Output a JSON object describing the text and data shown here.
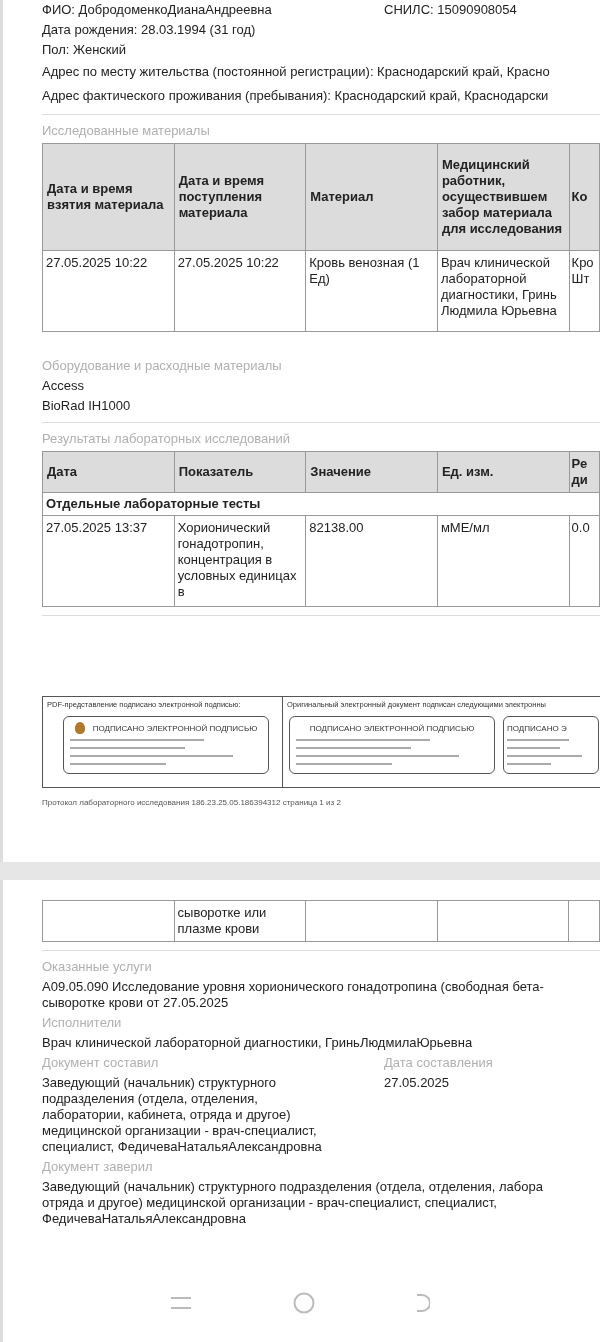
{
  "patient": {
    "name": "ФИО: ДобродоменкоДианаАндреевна",
    "snils": "СНИЛС: 15090908054",
    "birth": "Дата рождения: 28.03.1994 (31 год)",
    "sex": "Пол: Женский",
    "reg_address": "Адрес по месту жительства (постоянной регистрации): Краснодарский край, Красно",
    "actual_address": "Адрес фактического проживания (пребывания): Краснодарский край, Краснодарски"
  },
  "materials": {
    "title": "Исследованные материалы",
    "columns": [
      "Дата и время взятия материала",
      "Дата и время поступления материала",
      "Материал",
      "Медицинский работник, осуществившем забор материала для исследования",
      "Ко"
    ],
    "rows": [
      [
        "27.05.2025 10:22",
        "27.05.2025 10:22",
        "Кровь венозная (1 Ед)",
        "Врач клинической лабораторной диагностики, Гринь Людмила Юрьевна",
        "Кро Шт"
      ]
    ]
  },
  "equipment": {
    "title": "Оборудование и расходные материалы",
    "items": [
      "Access",
      "BioRad IH1000"
    ]
  },
  "results": {
    "title": "Результаты лабораторных исследований",
    "columns": [
      "Дата",
      "Показатель",
      "Значение",
      "Ед. изм.",
      "Ре ди"
    ],
    "group": "Отдельные лабораторные тесты",
    "rows": [
      [
        "27.05.2025 13:37",
        "Хорионический гонадотропин, концентрация в условных единицах в",
        "82138.00",
        "мМЕ/мл",
        "0.0"
      ]
    ]
  },
  "signatures": {
    "pdf_label": "PDF-представление подписано электронной подписью:",
    "original_label": "Оригинальный электронный документ подписан следующими электронны",
    "stamps": [
      {
        "heading": "ПОДПИСАНО ЭЛЕКТРОННОЙ ПОДПИСЬЮ",
        "kind": "emblem"
      },
      {
        "heading": "ПОДПИСАНО ЭЛЕКТРОННОЙ ПОДПИСЬЮ",
        "kind": "plain"
      },
      {
        "heading": "ПОДПИСАНО Э",
        "kind": "plain"
      }
    ]
  },
  "footer": "Протокол лабораторного исследования 186.23.25.05.186394312 страница 1 из 2",
  "page2": {
    "continued_row": {
      "indicator": "сыворотке или плазме крови"
    },
    "services": {
      "title": "Оказанные услуги",
      "lines": [
        "A09.05.090 Исследование уровня хорионического гонадотропина (свободная бета-",
        "сыворотке крови от 27.05.2025"
      ]
    },
    "performers": {
      "title": "Исполнители",
      "text": "Врач клинической лабораторной диагностики, ГриньЛюдмилаЮрьевна"
    },
    "composer": {
      "title": "Документ составил",
      "lines": [
        "Заведующий (начальник) структурного",
        "подразделения (отдела, отделения,",
        "лаборатории, кабинета, отряда и другое)",
        "медицинской организации - врач-специалист,",
        "специалист, ФедичеваНатальяАлександровна"
      ]
    },
    "date": {
      "title": "Дата составления",
      "text": "27.05.2025"
    },
    "certifier": {
      "title": "Документ заверил",
      "lines": [
        "Заведующий (начальник) структурного подразделения (отдела, отделения, лабора",
        "отряда и другое) медицинской организации - врач-специалист, специалист,",
        "ФедичеваНатальяАлександровна"
      ]
    }
  }
}
